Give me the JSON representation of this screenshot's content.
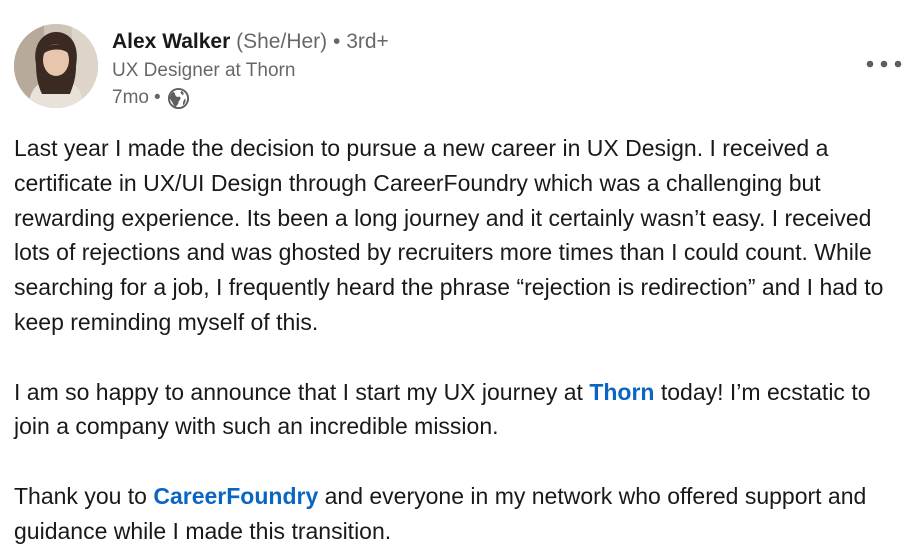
{
  "author": {
    "name": "Alex Walker",
    "pronouns": "(She/Her)",
    "separator": "•",
    "degree": "3rd+",
    "headline": "UX Designer at Thorn",
    "time": "7mo",
    "time_separator": "•",
    "visibility_icon": "globe-icon",
    "avatar_icon": "profile-photo"
  },
  "menu": {
    "icon": "more-horizontal-icon"
  },
  "post": {
    "paragraph1": "Last year I made the decision to pursue a new career in UX Design. I received a certificate in UX/UI Design through CareerFoundry which was a challenging but rewarding experience. Its been a long journey and it certainly wasn’t easy. I received lots of rejections and was ghosted by recruiters more times than I could count. While searching for a job, I frequently heard the phrase “rejection is redirection” and I had to keep reminding myself of this.",
    "paragraph2_before": "I am so happy to announce that I start my UX journey at ",
    "paragraph2_mention": "Thorn",
    "paragraph2_after": " today! I’m ecstatic to join a company with such an incredible mission.",
    "paragraph3_before": "Thank you to ",
    "paragraph3_mention": "CareerFoundry",
    "paragraph3_after": " and everyone in my network who offered support and guidance while I made this transition."
  },
  "colors": {
    "mention": "#0a66c2",
    "secondary_text": "#666666",
    "primary_text": "#191919"
  }
}
